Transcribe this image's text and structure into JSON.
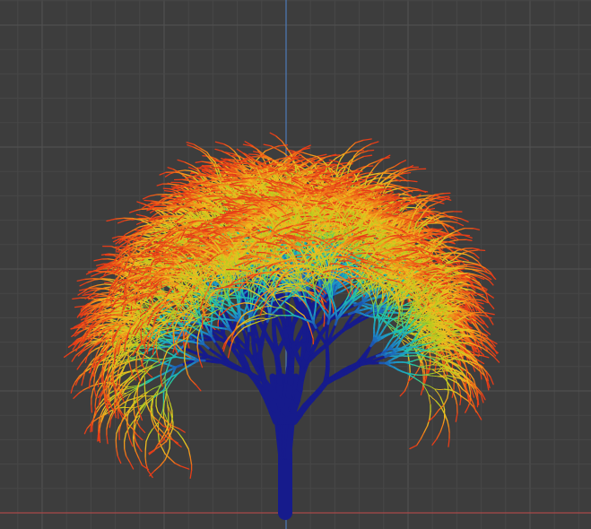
{
  "viewport": {
    "background": "#3d3d3d",
    "grid_minor_color": "#474747",
    "grid_major_color": "#525252",
    "x_axis_color": "#a84a4a",
    "y_axis_color": "#4d7ab8"
  },
  "tree": {
    "trunk_color": "#161b8c",
    "gradient": [
      "#1a1f9a",
      "#1e90c8",
      "#20c8a8",
      "#a8d020",
      "#f0c020",
      "#f07018",
      "#e02018"
    ],
    "seed": 20240517
  }
}
